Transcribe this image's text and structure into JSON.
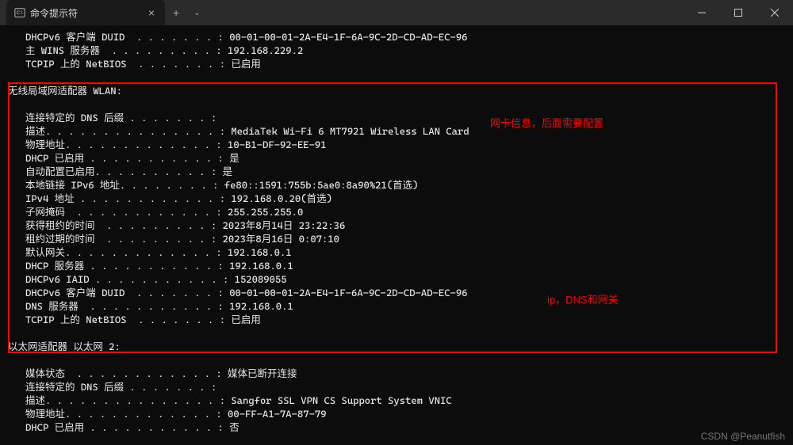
{
  "titlebar": {
    "tab_title": "命令提示符",
    "newtab_glyph": "+",
    "dropdown_glyph": "⌄"
  },
  "top_block": {
    "lines": [
      "   DHCPv6 客户端 DUID  . . . . . . . : 00-01-00-01-2A-E4-1F-6A-9C-2D-CD-AD-EC-96",
      "   主 WINS 服务器  . . . . . . . . . : 192.168.229.2",
      "   TCPIP 上的 NetBIOS  . . . . . . . : 已启用"
    ]
  },
  "wlan_block": {
    "header": "无线局域网适配器 WLAN:",
    "lines": [
      "   连接特定的 DNS 后缀 . . . . . . . :",
      "   描述. . . . . . . . . . . . . . . : MediaTek Wi-Fi 6 MT7921 Wireless LAN Card",
      "   物理地址. . . . . . . . . . . . . : 10-B1-DF-92-EE-91",
      "   DHCP 已启用 . . . . . . . . . . . : 是",
      "   自动配置已启用. . . . . . . . . . : 是",
      "   本地链接 IPv6 地址. . . . . . . . : fe80::1591:755b:5ae0:8a90%21(首选)",
      "   IPv4 地址 . . . . . . . . . . . . : 192.168.0.20(首选)",
      "   子网掩码  . . . . . . . . . . . . : 255.255.255.0",
      "   获得租约的时间  . . . . . . . . . : 2023年8月14日 23:22:36",
      "   租约过期的时间  . . . . . . . . . : 2023年8月16日 0:07:10",
      "   默认网关. . . . . . . . . . . . . : 192.168.0.1",
      "   DHCP 服务器 . . . . . . . . . . . : 192.168.0.1",
      "   DHCPv6 IAID . . . . . . . . . . . : 152089055",
      "   DHCPv6 客户端 DUID  . . . . . . . : 00-01-00-01-2A-E4-1F-6A-9C-2D-CD-AD-EC-96",
      "   DNS 服务器  . . . . . . . . . . . : 192.168.0.1",
      "   TCPIP 上的 NetBIOS  . . . . . . . : 已启用"
    ]
  },
  "eth2_block": {
    "header": "以太网适配器 以太网 2:",
    "lines": [
      "   媒体状态  . . . . . . . . . . . . : 媒体已断开连接",
      "   连接特定的 DNS 后缀 . . . . . . . :",
      "   描述. . . . . . . . . . . . . . . : Sangfor SSL VPN CS Support System VNIC",
      "   物理地址. . . . . . . . . . . . . : 00-FF-A1-7A-87-79",
      "   DHCP 已启用 . . . . . . . . . . . : 否"
    ]
  },
  "annotations": {
    "netcard": "网卡信息，后面需要配置",
    "ipdns": "ip，DNS和网关"
  },
  "watermark": "CSDN @Peanutfish"
}
